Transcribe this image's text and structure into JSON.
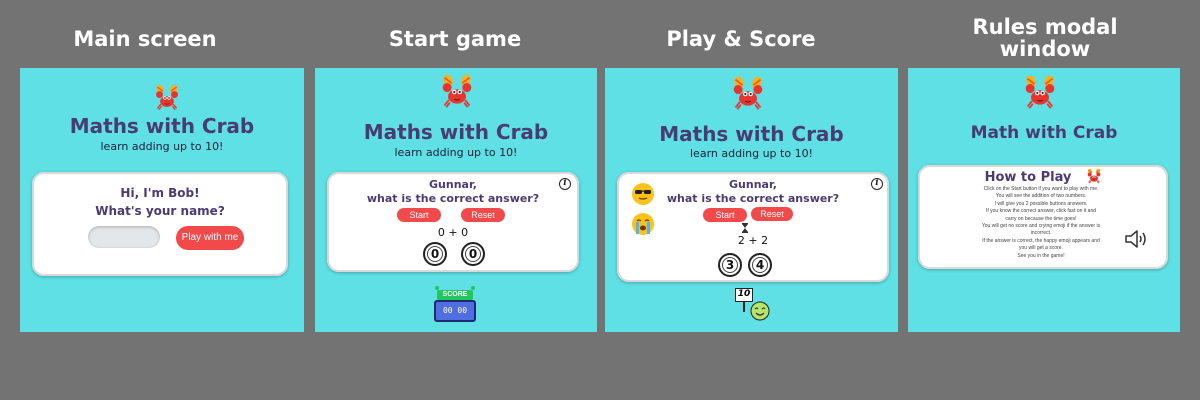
{
  "headings": [
    "Main screen",
    "Start game",
    "Play & Score",
    "Rules modal",
    "window"
  ],
  "panel1": {
    "title": "Maths with Crab",
    "subtitle": "learn adding up to 10!",
    "greeting": "Hi, I'm Bob!",
    "question": "What's your name?",
    "name_placeholder": "",
    "play_label": "Play with me"
  },
  "panel2": {
    "title": "Maths with Crab",
    "subtitle": "learn adding up to 10!",
    "player": "Gunnar,",
    "question": "what is the correct answer?",
    "start_label": "Start",
    "reset_label": "Reset",
    "sum": "0 + 0",
    "answers": [
      "0",
      "0"
    ],
    "score_label": "SCORE",
    "score_digits": "00 00"
  },
  "panel3": {
    "title": "Maths with Crab",
    "subtitle": "learn adding up to 10!",
    "player": "Gunnar,",
    "question": "what is the correct answer?",
    "start_label": "Start",
    "reset_label": "Reset",
    "sum": "2 + 2",
    "answers": [
      "3",
      "4"
    ],
    "score_sign": "10"
  },
  "panel4": {
    "title": "Math with Crab",
    "modal_title": "How to Play",
    "rules": [
      "Click on the Start button if you want to play with me.",
      "You will see the addition of two numbers.",
      "I will give you 2 possible buttons answers.",
      "If you know the correct answer, click fast on it and",
      "carry on because the time goes!",
      "You will get no score and crying emoji if the answer is",
      "incorrect.",
      "If the answer is correct, the happy emoji appears and",
      "you will get a score.",
      "See you in the game!"
    ]
  },
  "colors": {
    "panel_bg": "#5ee0e4",
    "accent_red": "#f24a4a",
    "title_purple": "#4a3b73",
    "page_bg": "#737373"
  },
  "icons": [
    "crab-icon",
    "info-icon",
    "cool-emoji-icon",
    "crying-emoji-icon",
    "hourglass-icon",
    "scoreboard-icon",
    "speaker-icon"
  ]
}
